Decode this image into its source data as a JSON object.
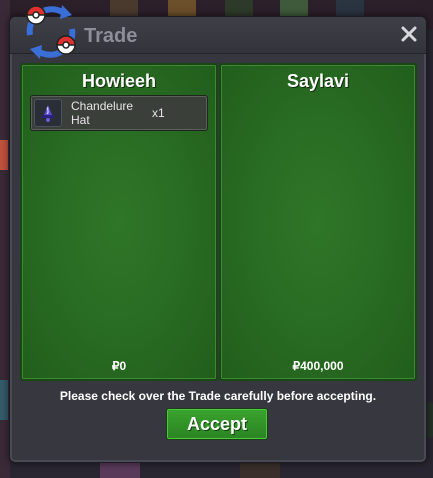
{
  "dialog": {
    "title": "Trade",
    "close_icon": "close-icon",
    "logo_icon": "trade-swap-pokeball-icon"
  },
  "left_panel": {
    "player_name": "Howieeh",
    "items": [
      {
        "icon": "chandelure-hat-icon",
        "name": "Chandelure Hat",
        "quantity": "x1"
      }
    ],
    "money": "₽0"
  },
  "right_panel": {
    "player_name": "Saylavi",
    "items": [],
    "money": "₽400,000"
  },
  "footer": {
    "notice": "Please check over the Trade carefully before accepting.",
    "accept_label": "Accept"
  },
  "colors": {
    "panel_green": "#286a22",
    "accept_green": "#2f9426",
    "dialog_bg": "#37373f"
  }
}
